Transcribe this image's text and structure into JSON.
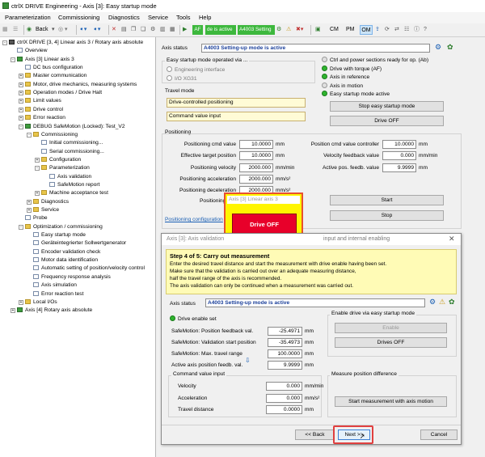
{
  "window": {
    "title": "ctrlX DRIVE Engineering - Axis [3]: Easy startup mode"
  },
  "menu": [
    "Parameterization",
    "Commissioning",
    "Diagnostics",
    "Service",
    "Tools",
    "Help"
  ],
  "toolbar": {
    "back_label": "Back",
    "mode_badge": "AF",
    "active_text": "de is active",
    "axis_combo": "A4003 Setting",
    "cm": "CM",
    "pm": "PM",
    "om": "OM"
  },
  "tree": [
    {
      "label": "ctrlX DRIVE [3, 4] Linear axis 3 / Rotary axis absolute",
      "level": 0,
      "icon": "drive",
      "tog": "-"
    },
    {
      "label": "Overview",
      "level": 1,
      "icon": "item",
      "tog": ""
    },
    {
      "label": "Axis [3] Linear axis 3",
      "level": 1,
      "icon": "green",
      "tog": "-"
    },
    {
      "label": "DC bus configuration",
      "level": 2,
      "icon": "item",
      "tog": ""
    },
    {
      "label": "Master communication",
      "level": 2,
      "icon": "folder",
      "tog": "+"
    },
    {
      "label": "Motor, drive mechanics, measuring systems",
      "level": 2,
      "icon": "folder",
      "tog": "+"
    },
    {
      "label": "Operation modes / Drive Halt",
      "level": 2,
      "icon": "folder",
      "tog": "+"
    },
    {
      "label": "Limit values",
      "level": 2,
      "icon": "folder",
      "tog": "+"
    },
    {
      "label": "Drive control",
      "level": 2,
      "icon": "folder",
      "tog": "+"
    },
    {
      "label": "Error reaction",
      "level": 2,
      "icon": "folder",
      "tog": "+"
    },
    {
      "label": "DEBUG SafeMotion (Locked): Test_V2",
      "level": 2,
      "icon": "green",
      "tog": "-"
    },
    {
      "label": "Commissioning",
      "level": 3,
      "icon": "folder",
      "tog": "-"
    },
    {
      "label": "Initial commissioning...",
      "level": 4,
      "icon": "item",
      "tog": ""
    },
    {
      "label": "Serial commissioning...",
      "level": 4,
      "icon": "item",
      "tog": ""
    },
    {
      "label": "Configuration",
      "level": 4,
      "icon": "folder",
      "tog": "+"
    },
    {
      "label": "Parameterization",
      "level": 4,
      "icon": "folder",
      "tog": "-"
    },
    {
      "label": "Axis validation",
      "level": 5,
      "icon": "item",
      "tog": ""
    },
    {
      "label": "SafeMotion report",
      "level": 5,
      "icon": "item",
      "tog": ""
    },
    {
      "label": "Machine acceptance test",
      "level": 4,
      "icon": "folder",
      "tog": "+"
    },
    {
      "label": "Diagnostics",
      "level": 3,
      "icon": "folder",
      "tog": "+"
    },
    {
      "label": "Service",
      "level": 3,
      "icon": "folder",
      "tog": "+"
    },
    {
      "label": "Probe",
      "level": 2,
      "icon": "item",
      "tog": ""
    },
    {
      "label": "Optimization / commissioning",
      "level": 2,
      "icon": "folder",
      "tog": "-"
    },
    {
      "label": "Easy startup mode",
      "level": 3,
      "icon": "item",
      "tog": ""
    },
    {
      "label": "Geräteintegrierter Sollwertgenerator",
      "level": 3,
      "icon": "item",
      "tog": ""
    },
    {
      "label": "Encoder validation check",
      "level": 3,
      "icon": "item",
      "tog": ""
    },
    {
      "label": "Motor data identification",
      "level": 3,
      "icon": "item",
      "tog": ""
    },
    {
      "label": "Automatic setting of position/velocity control",
      "level": 3,
      "icon": "item",
      "tog": ""
    },
    {
      "label": "Frequency response analysis",
      "level": 3,
      "icon": "item",
      "tog": ""
    },
    {
      "label": "Axis simulation",
      "level": 3,
      "icon": "item",
      "tog": ""
    },
    {
      "label": "Error reaction test",
      "level": 3,
      "icon": "item",
      "tog": ""
    },
    {
      "label": "Local I/Os",
      "level": 2,
      "icon": "folder",
      "tog": "+"
    },
    {
      "label": "Axis [4] Rotary axis absolute",
      "level": 1,
      "icon": "green",
      "tog": "+"
    }
  ],
  "main": {
    "axis_status_label": "Axis status",
    "axis_status_value": "A4003 Setting-up mode is active",
    "easy_group_title": "Easy startup mode operated via ...",
    "radio_engineering": "Engineering interface",
    "radio_io": "I/O XG31",
    "travel_mode_title": "Travel mode",
    "travel_mode_value": "Drive-controlled positioning",
    "command_value_input": "Command value input",
    "status_lights": [
      {
        "label": "Ctrl and power sections ready for op. (Ab)",
        "color": "grey"
      },
      {
        "label": "Drive with torque (AF)",
        "color": "green"
      },
      {
        "label": "Axis in reference",
        "color": "green"
      },
      {
        "label": "Axis in motion",
        "color": "grey"
      },
      {
        "label": "Easy startup mode active",
        "color": "green"
      }
    ],
    "stop_easy_btn": "Stop easy startup mode",
    "drive_off_btn": "Drive OFF",
    "positioning_title": "Positioning",
    "pos_rows": [
      {
        "label": "Positioning cmd value",
        "value": "10.0000",
        "unit": "mm"
      },
      {
        "label": "Effective target position",
        "value": "10.0000",
        "unit": "mm"
      },
      {
        "label": "Positioning velocity",
        "value": "2000.000",
        "unit": "mm/min"
      },
      {
        "label": "Positioning acceleration",
        "value": "2000.000",
        "unit": "mm/s²"
      },
      {
        "label": "Positioning deceleration",
        "value": "2000.000",
        "unit": "mm/s²"
      }
    ],
    "positioning_short": "Positioning",
    "right_rows": [
      {
        "label": "Position cmd value controller",
        "value": "10.0000",
        "unit": "mm"
      },
      {
        "label": "Velocity feedback value",
        "value": "0.000",
        "unit": "mm/min"
      },
      {
        "label": "Active pos. feedb. value",
        "value": "9.9999",
        "unit": "mm"
      }
    ],
    "start_btn": "Start",
    "stop_btn": "Stop",
    "positioning_config_link": "Positioning configuration"
  },
  "drive_popup": {
    "header": "Axis [3] Linear axis 3",
    "button": "Drive OFF"
  },
  "dialog": {
    "title_left": "Axis [3]: Axis validation",
    "title_right": "input and internal enabling",
    "step_title": "Step 4 of 5: Carry out measurement",
    "instructions": [
      "Enter the desired travel distance and start the measurement with drive enable having been set.",
      "Make sure that the validation is carried out over an adequate measuring distance,",
      "half the travel range of the axis is recommended.",
      "The axis validation can only be continued when a measurement was carried out."
    ],
    "axis_status_label": "Axis status",
    "axis_status_value": "A4003 Setting-up mode is active",
    "drive_enable_label": "Drive enable set",
    "safe_rows": [
      {
        "label": "SafeMotion: Position feedback val.",
        "value": "-25.4971",
        "unit": "mm"
      },
      {
        "label": "SafeMotion: Validation start position",
        "value": "-35.4973",
        "unit": "mm"
      },
      {
        "label": "SafeMotion: Max. travel range",
        "value": "100.0000",
        "unit": "mm"
      },
      {
        "label": "Active axis position feedb. val.",
        "value": "9.9999",
        "unit": "mm"
      }
    ],
    "enable_group_title": "Enable drive via easy startup mode",
    "enable_btn": "Enable",
    "drives_off_btn": "Drives OFF",
    "cmd_group_title": "Command value input",
    "cmd_rows": [
      {
        "label": "Velocity",
        "value": "0.000",
        "unit": "mm/min"
      },
      {
        "label": "Acceleration",
        "value": "0.000",
        "unit": "mm/s²"
      },
      {
        "label": "Travel distance",
        "value": "0.0000",
        "unit": "mm"
      }
    ],
    "measure_group_title": "Measure position difference",
    "measure_btn": "Start measurement with axis motion",
    "back_btn": "<< Back",
    "next_btn": "Next >>",
    "cancel_btn": "Cancel"
  },
  "colors": {
    "highlight_red": "#e04040",
    "info_yellow": "#fffbb6",
    "drive_off_red": "#e8002a",
    "status_green": "#2fb52f"
  }
}
